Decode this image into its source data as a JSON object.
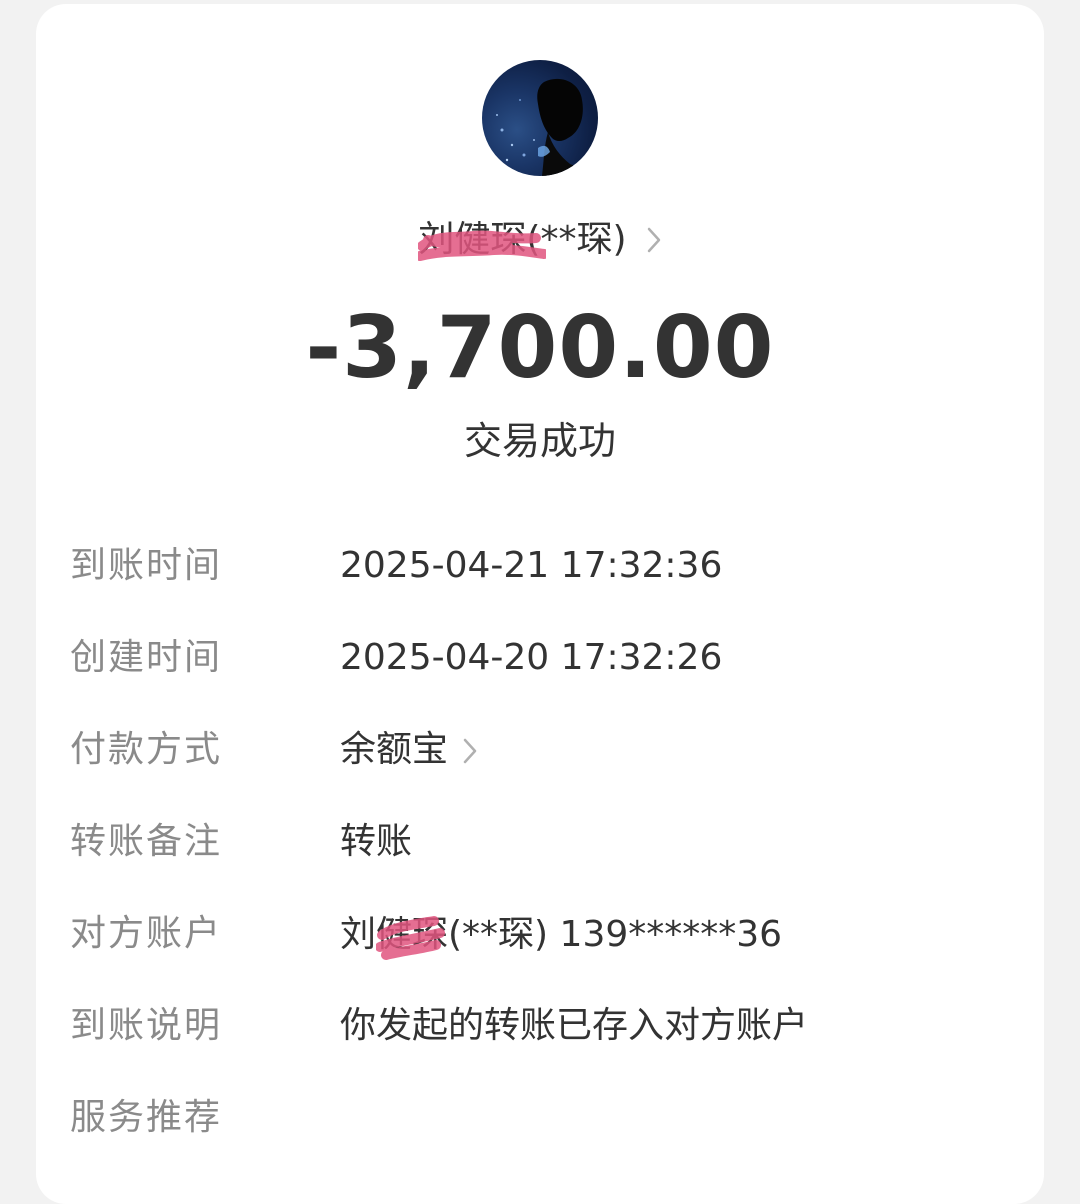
{
  "counterparty": {
    "display_name": "刘健琛(**琛)"
  },
  "transaction": {
    "amount": "-3,700.00",
    "status": "交易成功"
  },
  "details": [
    {
      "label": "到账时间",
      "value": "2025-04-21 17:32:36"
    },
    {
      "label": "创建时间",
      "value": "2025-04-20 17:32:26"
    },
    {
      "label": "付款方式",
      "value": "余额宝"
    },
    {
      "label": "转账备注",
      "value": "转账"
    },
    {
      "label": "对方账户",
      "value": "刘健琛(**琛) 139******36"
    },
    {
      "label": "到账说明",
      "value": "你发起的转账已存入对方账户"
    },
    {
      "label": "服务推荐",
      "value": ""
    }
  ],
  "colors": {
    "label_gray": "#8a8a8a",
    "text_dark": "#333333",
    "scribble_pink": "#e0557f",
    "chevron_gray": "#b0b0b0"
  },
  "icons": {
    "avatar": "avatar-image",
    "chevron": "chevron-right-icon"
  }
}
